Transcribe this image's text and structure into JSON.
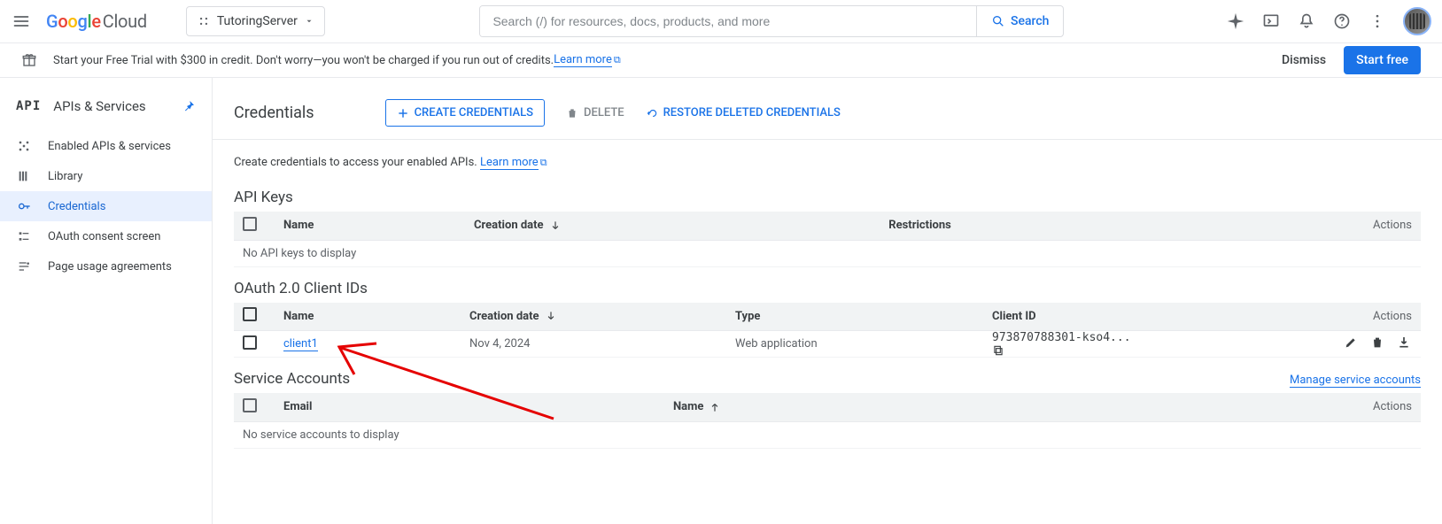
{
  "header": {
    "logo_cloud": "Cloud",
    "project": "TutoringServer",
    "search_placeholder": "Search (/) for resources, docs, products, and more",
    "search_btn": "Search"
  },
  "banner": {
    "text": "Start your Free Trial with $300 in credit. Don't worry—you won't be charged if you run out of credits. ",
    "learn": "Learn more",
    "dismiss": "Dismiss",
    "start": "Start free"
  },
  "side": {
    "title": "APIs & Services",
    "items": [
      "Enabled APIs & services",
      "Library",
      "Credentials",
      "OAuth consent screen",
      "Page usage agreements"
    ]
  },
  "page": {
    "title": "Credentials",
    "create": "CREATE CREDENTIALS",
    "delete": "DELETE",
    "restore": "RESTORE DELETED CREDENTIALS",
    "helper_a": "Create credentials to access your enabled APIs. ",
    "helper_link": "Learn more",
    "actions_hdr": "Actions"
  },
  "api_keys": {
    "title": "API Keys",
    "cols": {
      "name": "Name",
      "creation": "Creation date",
      "restrictions": "Restrictions"
    },
    "empty": "No API keys to display"
  },
  "oauth": {
    "title": "OAuth 2.0 Client IDs",
    "cols": {
      "name": "Name",
      "creation": "Creation date",
      "type": "Type",
      "client_id": "Client ID"
    },
    "row": {
      "name": "client1",
      "creation": "Nov 4, 2024",
      "type": "Web application",
      "client_id": "973870788301-kso4..."
    }
  },
  "svc": {
    "title": "Service Accounts",
    "manage": "Manage service accounts",
    "cols": {
      "email": "Email",
      "name": "Name"
    },
    "empty": "No service accounts to display"
  }
}
